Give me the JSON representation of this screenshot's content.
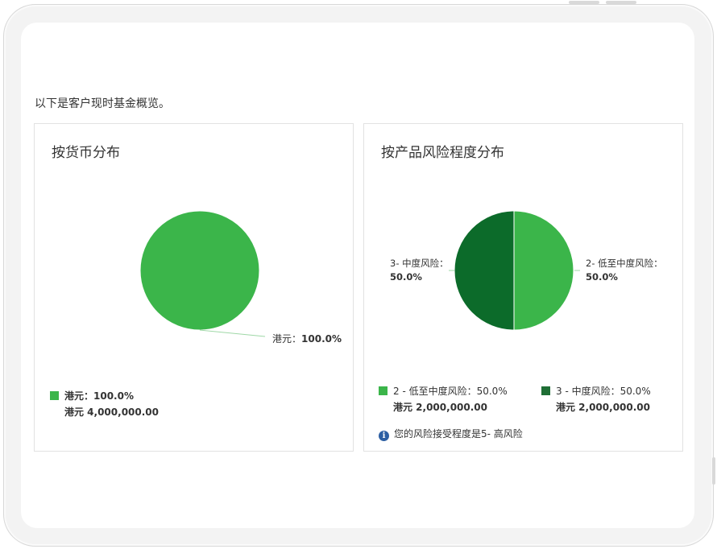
{
  "intro": "以下是客户现时基金概览。",
  "colors": {
    "green_light": "#3bb54a",
    "green_dark": "#0c6b2a"
  },
  "chart_data": [
    {
      "type": "pie",
      "title": "按货币分布",
      "slices": [
        {
          "name": "港元",
          "pct_label": "100.0%",
          "value": 100.0,
          "amount_label": "港元 4,000,000.00",
          "color": "#3bb54a"
        }
      ],
      "data_labels": [
        {
          "name": "港元：",
          "value": "100.0%"
        }
      ],
      "legend": [
        {
          "label": "港元：100.0%",
          "amount": "港元 4,000,000.00"
        }
      ]
    },
    {
      "type": "pie",
      "title": "按产品风险程度分布",
      "slices": [
        {
          "name": "2- 低至中度风险",
          "value": 50.0,
          "color": "#3bb54a"
        },
        {
          "name": "3- 中度风险",
          "value": 50.0,
          "color": "#0c6b2a"
        }
      ],
      "data_labels": [
        {
          "name": "2- 低至中度风险：",
          "value": "50.0%"
        },
        {
          "name": "3- 中度风险：",
          "value": "50.0%"
        }
      ],
      "legend": [
        {
          "label": "2 - 低至中度风险：50.0%",
          "amount": "港元 2,000,000.00"
        },
        {
          "label": "3 - 中度风险：50.0%",
          "amount": "港元 2,000,000.00"
        }
      ],
      "note": "您的风险接受程度是5- 高风险"
    }
  ]
}
